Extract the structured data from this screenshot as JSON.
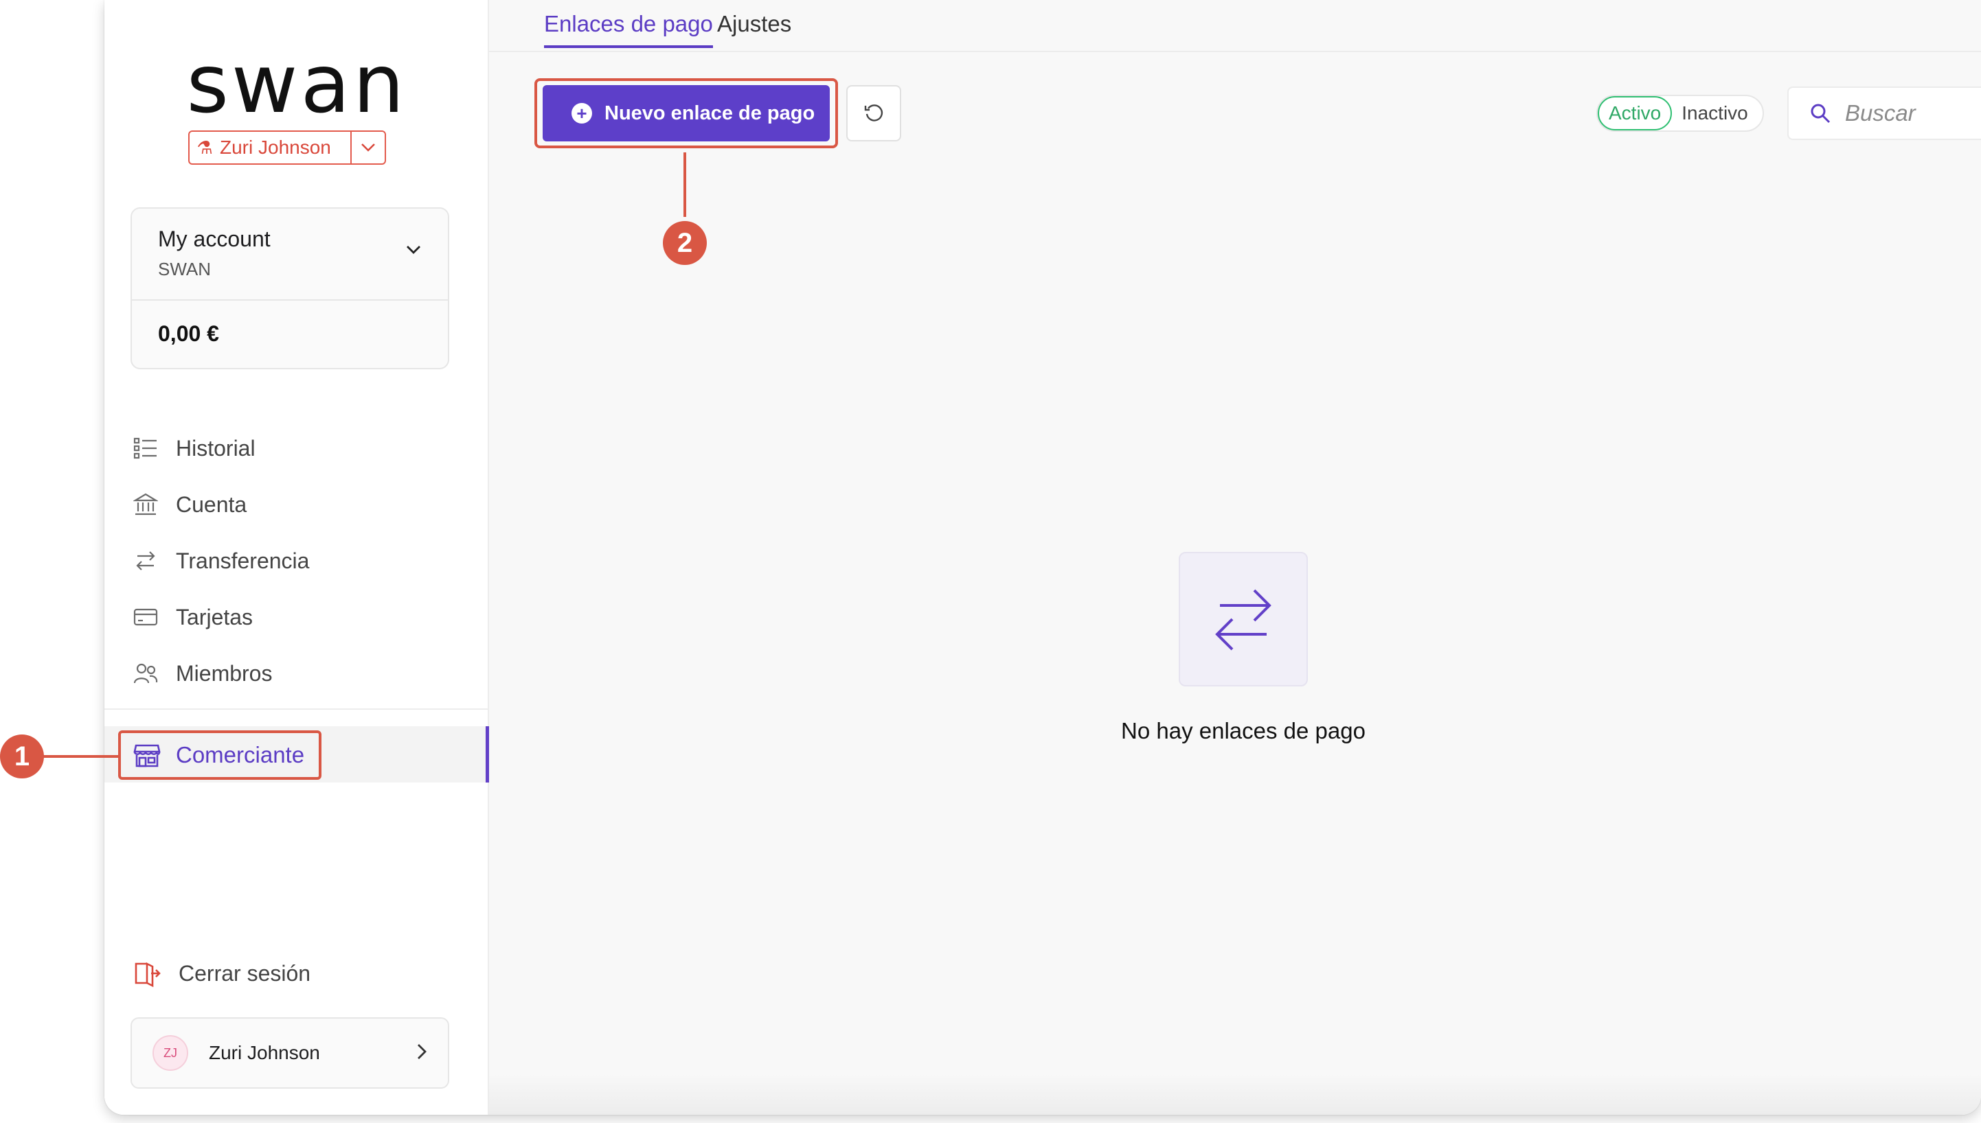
{
  "sidebar": {
    "logo": "swan",
    "sandbox_user": "Zuri Johnson",
    "account": {
      "name": "My account",
      "subtitle": "SWAN",
      "balance": "0,00 €"
    },
    "nav": [
      {
        "label": "Historial",
        "icon": "list-icon"
      },
      {
        "label": "Cuenta",
        "icon": "bank-icon"
      },
      {
        "label": "Transferencia",
        "icon": "transfer-icon"
      },
      {
        "label": "Tarjetas",
        "icon": "card-icon"
      },
      {
        "label": "Miembros",
        "icon": "members-icon"
      }
    ],
    "merchant": {
      "label": "Comerciante",
      "icon": "store-icon"
    },
    "logout": "Cerrar sesión",
    "user": {
      "initials": "ZJ",
      "name": "Zuri Johnson"
    }
  },
  "main": {
    "tabs": [
      {
        "label": "Enlaces de pago",
        "active": true
      },
      {
        "label": "Ajustes",
        "active": false
      }
    ],
    "new_button": "Nuevo enlace de pago",
    "filter": {
      "active": "Activo",
      "inactive": "Inactivo"
    },
    "search": {
      "placeholder": "Buscar",
      "value": ""
    },
    "empty_message": "No hay enlaces de pago"
  },
  "callouts": [
    "1",
    "2"
  ],
  "colors": {
    "accent": "#5d3fc9",
    "highlight": "#d95744",
    "success": "#2fbf72",
    "sandbox": "#e35a4c"
  }
}
